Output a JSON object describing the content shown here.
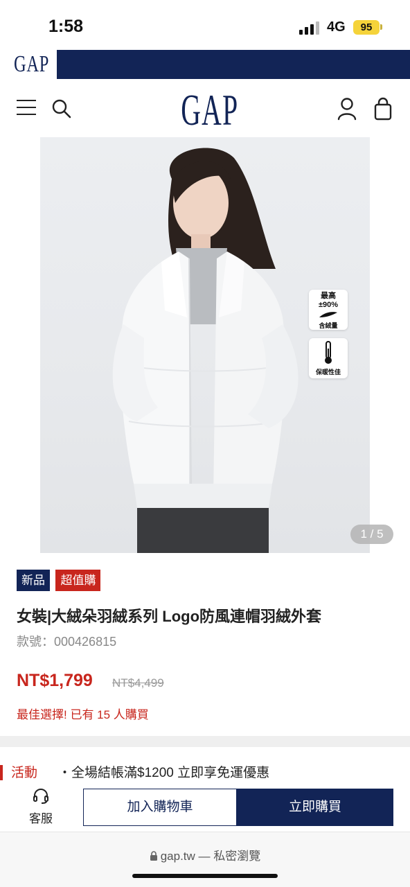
{
  "status_bar": {
    "time": "1:58",
    "network": "4G",
    "battery": "95",
    "colors": {
      "battery": "#f5d33a"
    }
  },
  "brand": {
    "name": "GAP",
    "color": "#122456"
  },
  "header": {
    "logo": "GAP",
    "icons": [
      "menu-icon",
      "search-icon",
      "account-icon",
      "bag-icon"
    ]
  },
  "gallery": {
    "pager": "1 / 5",
    "badges": {
      "down": {
        "line1": "最高",
        "line2": "±90%",
        "line3": "含絨量"
      },
      "warm": {
        "label": "保暖性佳"
      }
    }
  },
  "product": {
    "tags": {
      "new": "新品",
      "value": "超值購"
    },
    "title": "女裝|大絨朵羽絨系列 Logo防風連帽羽絨外套",
    "sku": "款號：000426815",
    "price": "NT$1,799",
    "original_price": "NT$4,499",
    "popularity": "最佳選擇! 已有 15 人購買",
    "colors": {
      "sale": "#c8261d",
      "navy": "#122456"
    }
  },
  "promo": {
    "label": "活動",
    "text": "・全場結帳滿$1200 立即享免運優惠"
  },
  "actions": {
    "support": "客服",
    "add_to_cart": "加入購物車",
    "buy_now": "立即購買"
  },
  "browser": {
    "url": "gap.tw — 私密瀏覽"
  }
}
